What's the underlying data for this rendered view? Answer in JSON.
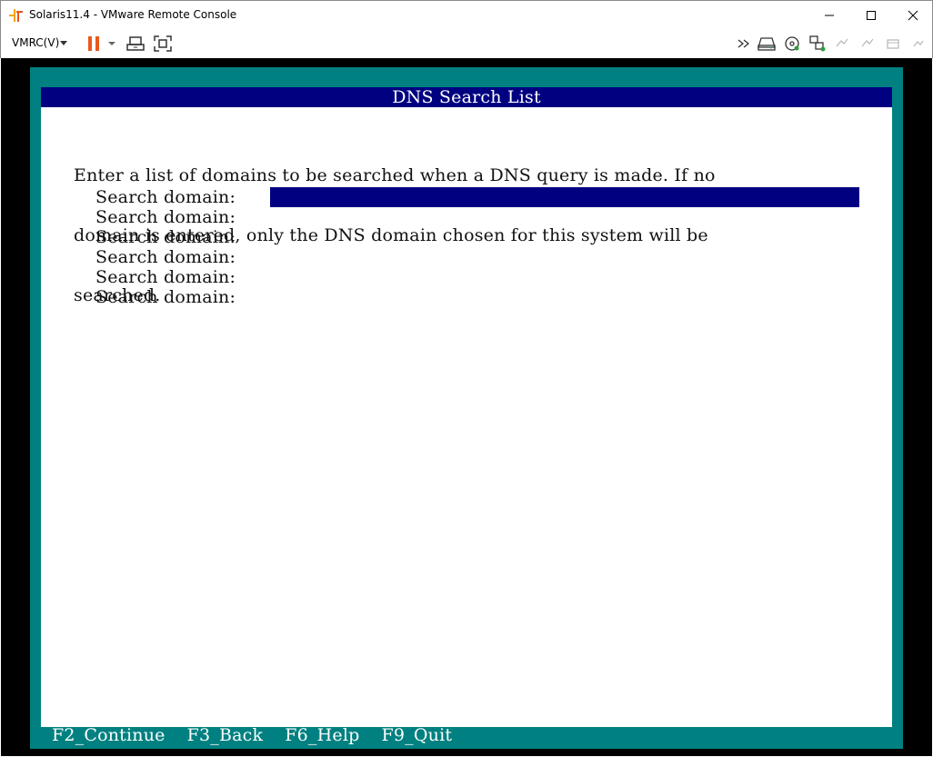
{
  "window": {
    "title": "Solaris11.4 - VMware Remote Console",
    "controls": [
      "minimize",
      "maximize",
      "close"
    ]
  },
  "toolbar": {
    "menu_label": "VMRC(V)",
    "icons": [
      "pause-icon",
      "dropdown-caret-icon",
      "send-ctrl-alt-del-icon",
      "fullscreen-icon",
      "forward-icon",
      "removable-drive-icon",
      "cd-dvd-icon",
      "network-adapter-icon",
      "usb-icon",
      "usb-icon-2",
      "printer-icon"
    ]
  },
  "installer": {
    "header": "DNS Search List",
    "description_lines": [
      "Enter a list of domains to be searched when a DNS query is made. If no",
      "domain is entered, only the DNS domain chosen for this system will be",
      "searched."
    ],
    "fields": [
      {
        "label": "Search domain:",
        "value": ""
      },
      {
        "label": "Search domain:",
        "value": ""
      },
      {
        "label": "Search domain:",
        "value": ""
      },
      {
        "label": "Search domain:",
        "value": ""
      },
      {
        "label": "Search domain:",
        "value": ""
      },
      {
        "label": "Search domain:",
        "value": ""
      }
    ],
    "footer": [
      "F2_Continue",
      "F3_Back",
      "F6_Help",
      "F9_Quit"
    ]
  },
  "colors": {
    "header_bg": "#000080",
    "frame": "#008080",
    "screen_bg": "#ffffff",
    "pause_accent": "#e8581c"
  }
}
